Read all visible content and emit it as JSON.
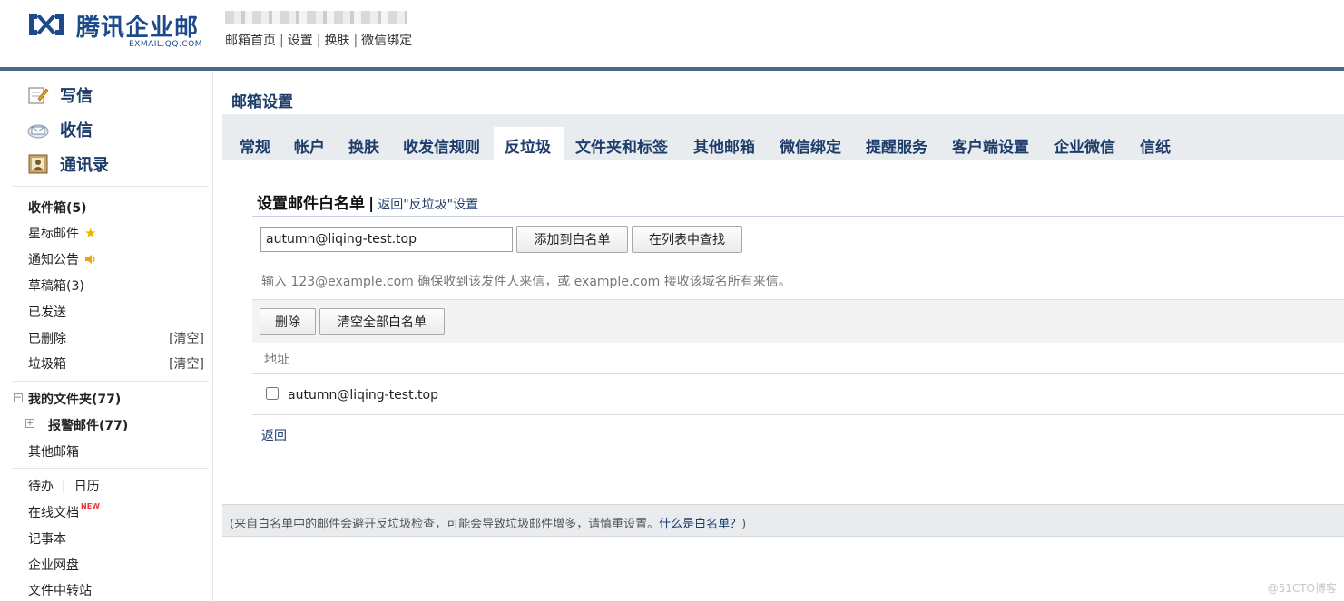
{
  "header": {
    "logo_text": "腾讯企业邮",
    "logo_sub": "EXMAIL.QQ.COM",
    "links": [
      "邮箱首页",
      "设置",
      "换肤",
      "微信绑定"
    ],
    "separator": "|"
  },
  "sidebar": {
    "actions": [
      {
        "label": "写信",
        "icon": "compose-icon"
      },
      {
        "label": "收信",
        "icon": "inbox-icon"
      },
      {
        "label": "通讯录",
        "icon": "contacts-icon"
      }
    ],
    "folders": [
      {
        "label": "收件箱(5)"
      },
      {
        "label": "星标邮件"
      },
      {
        "label": "通知公告"
      },
      {
        "label": "草稿箱(3)"
      },
      {
        "label": "已发送"
      },
      {
        "label": "已删除",
        "clear": "[清空]"
      },
      {
        "label": "垃圾箱",
        "clear": "[清空]"
      }
    ],
    "my_folders": "我的文件夹(77)",
    "alert_folder": "报警邮件(77)",
    "other_mailbox": "其他邮箱",
    "tools": {
      "todo": "待办",
      "calendar": "日历",
      "online_docs": "在线文档",
      "new_badge": "NEW",
      "notes": "记事本",
      "netdisk": "企业网盘",
      "transfer": "文件中转站"
    }
  },
  "main": {
    "page_title": "邮箱设置",
    "tabs": [
      "常规",
      "帐户",
      "换肤",
      "收发信规则",
      "反垃圾",
      "文件夹和标签",
      "其他邮箱",
      "微信绑定",
      "提醒服务",
      "客户端设置",
      "企业微信",
      "信纸"
    ],
    "active_tab": "反垃圾",
    "section_title": "设置邮件白名单",
    "section_bar": "|",
    "back_setting": "返回\"反垃圾\"设置",
    "input_value": "autumn@liqing-test.top",
    "add_button": "添加到白名单",
    "find_button": "在列表中查找",
    "hint": "输入 123@example.com 确保收到该发件人来信，或 example.com 接收该域名所有来信。",
    "delete_button": "删除",
    "clear_all_button": "清空全部白名单",
    "column_header": "地址",
    "rows": [
      {
        "address": "autumn@liqing-test.top",
        "checked": false
      }
    ],
    "back_link": "返回",
    "footer_note": "(来自白名单中的邮件会避开反垃圾检查，可能会导致垃圾邮件增多，请慎重设置。",
    "footer_question": "什么是白名单？",
    "footer_close": ")"
  },
  "watermark": "@51CTO博客"
}
